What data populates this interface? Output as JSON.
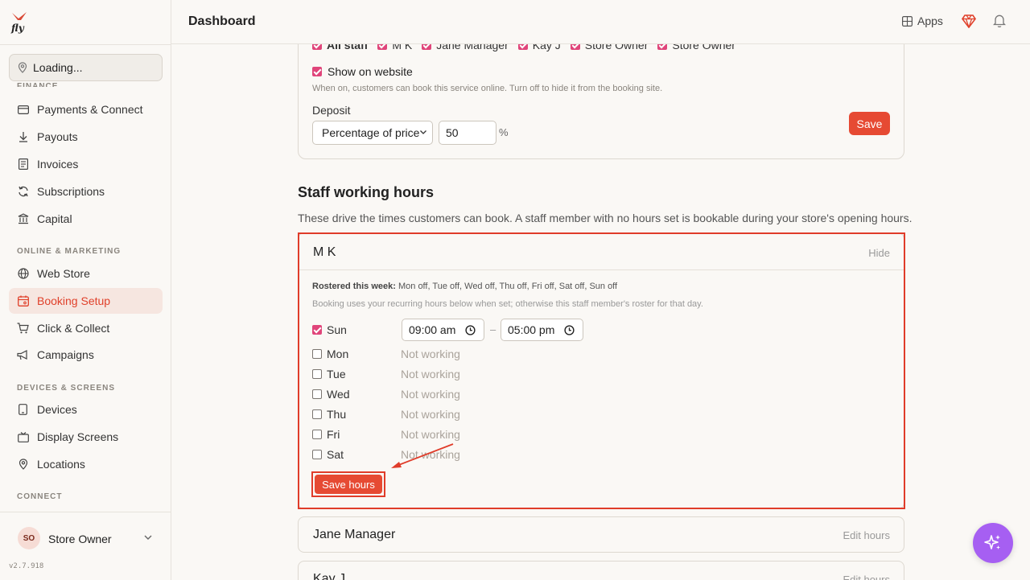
{
  "header": {
    "title": "Dashboard",
    "apps_label": "Apps"
  },
  "sidebar": {
    "location": "Loading...",
    "sections": {
      "finance": "FINANCE",
      "online_marketing": "ONLINE & MARKETING",
      "devices_screens": "DEVICES & SCREENS",
      "connect": "CONNECT"
    },
    "items": [
      {
        "label": "Payments & Connect",
        "icon": "card-icon"
      },
      {
        "label": "Payouts",
        "icon": "download-icon"
      },
      {
        "label": "Invoices",
        "icon": "invoice-icon"
      },
      {
        "label": "Subscriptions",
        "icon": "refresh-icon"
      },
      {
        "label": "Capital",
        "icon": "bank-icon"
      },
      {
        "label": "Web Store",
        "icon": "globe-icon"
      },
      {
        "label": "Booking Setup",
        "icon": "calendar-icon",
        "active": true
      },
      {
        "label": "Click & Collect",
        "icon": "cart-icon"
      },
      {
        "label": "Campaigns",
        "icon": "megaphone-icon"
      },
      {
        "label": "Devices",
        "icon": "device-icon"
      },
      {
        "label": "Display Screens",
        "icon": "screen-icon"
      },
      {
        "label": "Locations",
        "icon": "pin-icon"
      }
    ],
    "user": {
      "initials": "SO",
      "name": "Store Owner"
    },
    "version": "v2.7.918"
  },
  "service_card": {
    "staff": [
      "All staff",
      "M K",
      "Jane Manager",
      "Kay J",
      "Store Owner",
      "Store Owner"
    ],
    "show_on_website": {
      "label": "Show on website",
      "checked": true,
      "help": "When on, customers can book this service online. Turn off to hide it from the booking site."
    },
    "deposit": {
      "label": "Deposit",
      "type": "Percentage of price",
      "value": "50",
      "unit": "%"
    },
    "save_label": "Save"
  },
  "staff_hours": {
    "title": "Staff working hours",
    "description": "These drive the times customers can book. A staff member with no hours set is bookable during your store's opening hours.",
    "expanded": {
      "name": "M K",
      "hide_label": "Hide",
      "rostered_label": "Rostered this week:",
      "rostered_value": "Mon off, Tue off, Wed off, Thu off, Fri off, Sat off, Sun off",
      "roster_help": "Booking uses your recurring hours below when set; otherwise this staff member's roster for that day.",
      "days": [
        {
          "name": "Sun",
          "working": true,
          "start": "09:00 am",
          "end": "05:00 pm"
        },
        {
          "name": "Mon",
          "working": false,
          "status": "Not working"
        },
        {
          "name": "Tue",
          "working": false,
          "status": "Not working"
        },
        {
          "name": "Wed",
          "working": false,
          "status": "Not working"
        },
        {
          "name": "Thu",
          "working": false,
          "status": "Not working"
        },
        {
          "name": "Fri",
          "working": false,
          "status": "Not working"
        },
        {
          "name": "Sat",
          "working": false,
          "status": "Not working"
        }
      ],
      "range_separator": "–",
      "save_label": "Save hours"
    },
    "collapsed": [
      {
        "name": "Jane Manager",
        "edit_label": "Edit hours"
      },
      {
        "name": "Kay J",
        "edit_label": "Edit hours"
      }
    ]
  },
  "colors": {
    "accent": "#e64a33",
    "checkbox": "#e0457a",
    "highlight": "#e03c2a",
    "fab": "#a65ff2"
  }
}
